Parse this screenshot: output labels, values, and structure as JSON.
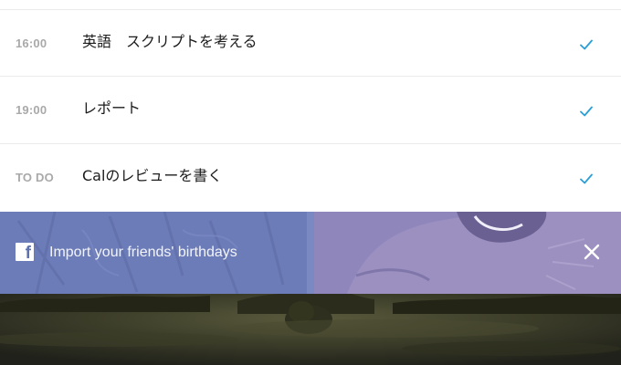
{
  "tasks": [
    {
      "time": "16:00",
      "title": "英語　スクリプトを考える",
      "icon": "checkmark-icon",
      "done": true
    },
    {
      "time": "19:00",
      "title": "レポート",
      "icon": "checkmark-icon",
      "done": true
    },
    {
      "time": "TO DO",
      "title": "Calのレビューを書く",
      "icon": "checkmark-icon",
      "done": true
    }
  ],
  "banner": {
    "icon": "facebook-icon",
    "icon_glyph": "f",
    "text": "Import your friends' birthdays",
    "close_icon": "close-icon"
  },
  "colors": {
    "accent": "#2a9fd6",
    "time_text": "#a9a9a9",
    "title_text": "#1b1b1b",
    "banner_overlay": "#6578b8",
    "divider": "#ebebeb"
  }
}
